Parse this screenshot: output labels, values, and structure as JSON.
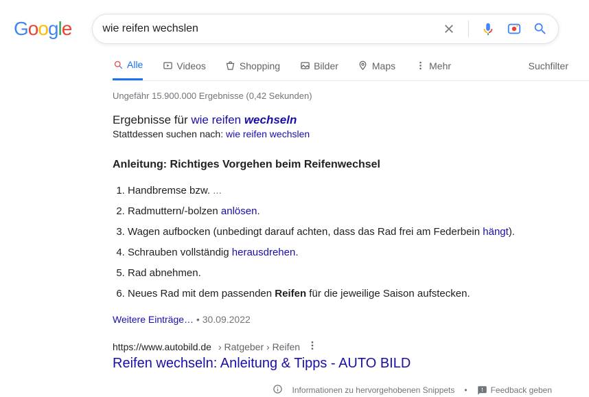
{
  "search": {
    "query": "wie reifen wechslen",
    "tabs": {
      "alle": "Alle",
      "videos": "Videos",
      "shopping": "Shopping",
      "bilder": "Bilder",
      "maps": "Maps",
      "mehr": "Mehr"
    },
    "suchfilter": "Suchfilter",
    "stats": "Ungefähr 15.900.000 Ergebnisse (0,42 Sekunden)"
  },
  "spell": {
    "prefix1": "Ergebnisse für ",
    "corrected_plain": "wie reifen ",
    "corrected_em": "wechseln",
    "prefix2": "Stattdessen suchen nach: ",
    "original": "wie reifen wechslen"
  },
  "snippet": {
    "title": "Anleitung: Richtiges Vorgehen beim Reifenwechsel",
    "steps": [
      {
        "text": "Handbremse bzw.",
        "trailing": " ..."
      },
      {
        "text_before": "Radmuttern/-bolzen ",
        "link": "anlösen",
        "text_after": "."
      },
      {
        "text_before": "Wagen aufbocken (unbedingt darauf achten, dass das Rad frei am Federbein ",
        "link": "hängt",
        "text_after": ")."
      },
      {
        "text_before": "Schrauben vollständig ",
        "link": "herausdrehen",
        "text_after": "."
      },
      {
        "text": "Rad abnehmen."
      },
      {
        "text_before": "Neues Rad mit dem passenden ",
        "bold": "Reifen",
        "text_after": " für die jeweilige Saison aufstecken."
      }
    ],
    "more_items": "Weitere Einträge…",
    "date": "30.09.2022"
  },
  "result": {
    "url_host": "https://www.autobild.de",
    "url_path": " › Ratgeber › Reifen",
    "title": "Reifen wechseln: Anleitung & Tipps - AUTO BILD"
  },
  "footer": {
    "info": "Informationen zu hervorgehobenen Snippets",
    "feedback": "Feedback geben"
  }
}
